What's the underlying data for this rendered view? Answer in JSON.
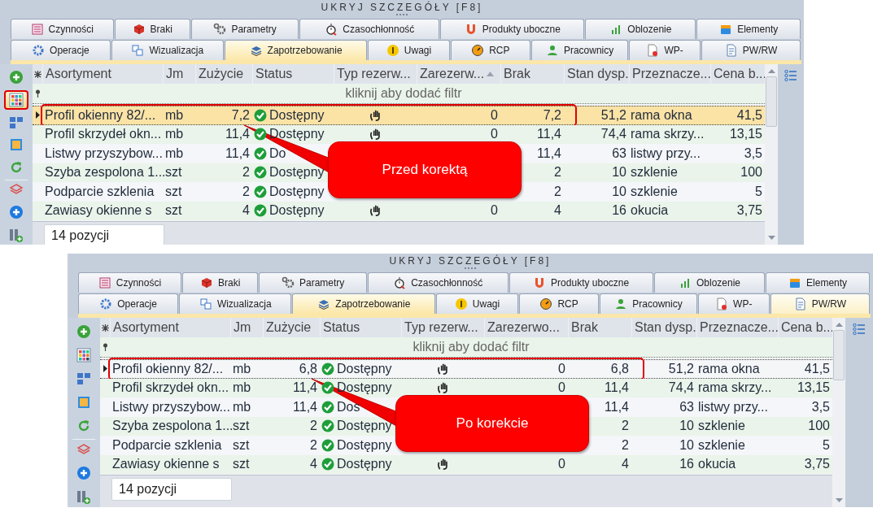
{
  "panels": [
    {
      "header": "UKRYJ SZCZEGÓŁY [F8]",
      "tabs_row_1": [
        {
          "label": "Czynności",
          "selected": false,
          "hover": false
        },
        {
          "label": "Braki",
          "selected": false,
          "hover": false
        },
        {
          "label": "Parametry",
          "selected": false,
          "hover": false
        },
        {
          "label": "Czasochłonność",
          "selected": false,
          "hover": false
        },
        {
          "label": "Produkty uboczne",
          "selected": false,
          "hover": false
        },
        {
          "label": "Oblozenie",
          "selected": false,
          "hover": false
        },
        {
          "label": "Elementy",
          "selected": false,
          "hover": false
        }
      ],
      "tabs_row_2": [
        {
          "label": "Operacje",
          "selected": false,
          "hover": false
        },
        {
          "label": "Wizualizacja",
          "selected": false,
          "hover": false
        },
        {
          "label": "Zapotrzebowanie",
          "selected": true,
          "hover": false
        },
        {
          "label": "Uwagi",
          "selected": false,
          "hover": false
        },
        {
          "label": "RCP",
          "selected": false,
          "hover": false
        },
        {
          "label": "Pracownicy",
          "selected": false,
          "hover": false
        },
        {
          "label": "WP-",
          "selected": false,
          "hover": false
        },
        {
          "label": "PW/RW",
          "selected": false,
          "hover": false
        }
      ],
      "toolbar": [
        {
          "selected": false,
          "outlined": false
        },
        {
          "selected": true,
          "outlined": true
        },
        {
          "selected": false,
          "outlined": false
        },
        {
          "selected": false,
          "outlined": false
        },
        {
          "selected": false,
          "outlined": false
        },
        {
          "selected": false,
          "outlined": false
        },
        {
          "selected": false,
          "outlined": false
        },
        {
          "selected": false,
          "outlined": false
        }
      ],
      "grid_focused": true,
      "columns": [
        {
          "label": "Asortyment"
        },
        {
          "label": "Jm"
        },
        {
          "label": "Zużycie"
        },
        {
          "label": "Status"
        },
        {
          "label": "Typ rezerw..."
        },
        {
          "label": "Zarezerw...",
          "sort_ascending": true
        },
        {
          "label": "Brak"
        },
        {
          "label": "Stan dysp."
        },
        {
          "label": "Przeznacze..."
        },
        {
          "label": "Cena b..."
        }
      ],
      "filter_hint": "kliknij aby dodać filtr",
      "rows": [
        {
          "name": "Profil okienny 82/...",
          "unit": "mb",
          "usage": "7,2",
          "status": "Dostępny",
          "reservation_icon": true,
          "reserved": "0",
          "shortage": "7,2",
          "available": "51,2",
          "purpose": "rama okna",
          "price": "41,5",
          "selected": true,
          "outlined": true
        },
        {
          "name": "Profil skrzydeł okn...",
          "unit": "mb",
          "usage": "11,4",
          "status": "Dostępny",
          "reservation_icon": true,
          "reserved": "0",
          "shortage": "11,4",
          "available": "74,4",
          "purpose": "rama skrzy...",
          "price": "13,15",
          "selected": false,
          "outlined": false
        },
        {
          "name": "Listwy przyszybow...",
          "unit": "mb",
          "usage": "11,4",
          "status": "Do",
          "shortage": "11,4",
          "available": "63",
          "purpose": "listwy przy...",
          "price": "3,5",
          "selected": false,
          "outlined": false
        },
        {
          "name": "Szyba zespolona 1...",
          "unit": "szt",
          "usage": "2",
          "status": "Dostępny",
          "shortage": "2",
          "available": "10",
          "purpose": "szklenie",
          "price": "100",
          "selected": false,
          "outlined": false
        },
        {
          "name": "Podparcie szklenia",
          "unit": "szt",
          "usage": "2",
          "status": "Dostępny",
          "shortage": "2",
          "available": "10",
          "purpose": "szklenie",
          "price": "5",
          "selected": false,
          "outlined": false
        },
        {
          "name": "Zawiasy okienne s",
          "unit": "szt",
          "usage": "4",
          "status": "Dostępny",
          "reservation_icon": true,
          "reserved": "0",
          "shortage": "4",
          "available": "16",
          "purpose": "okucia",
          "price": "3,75",
          "selected": false,
          "outlined": false
        }
      ],
      "count": "14 pozycji",
      "callout": "Przed korektą"
    },
    {
      "header": "UKRYJ SZCZEGÓŁY [F8]",
      "tabs_row_1": [
        {
          "label": "Czynności",
          "selected": false,
          "hover": false
        },
        {
          "label": "Braki",
          "selected": false,
          "hover": false
        },
        {
          "label": "Parametry",
          "selected": false,
          "hover": false
        },
        {
          "label": "Czasochłonność",
          "selected": false,
          "hover": false
        },
        {
          "label": "Produkty uboczne",
          "selected": false,
          "hover": false
        },
        {
          "label": "Oblozenie",
          "selected": false,
          "hover": false
        },
        {
          "label": "Elementy",
          "selected": false,
          "hover": false
        }
      ],
      "tabs_row_2": [
        {
          "label": "Operacje",
          "selected": false,
          "hover": false
        },
        {
          "label": "Wizualizacja",
          "selected": false,
          "hover": false
        },
        {
          "label": "Zapotrzebowanie",
          "selected": true,
          "hover": false
        },
        {
          "label": "Uwagi",
          "selected": false,
          "hover": false
        },
        {
          "label": "RCP",
          "selected": false,
          "hover": false
        },
        {
          "label": "Pracownicy",
          "selected": false,
          "hover": false
        },
        {
          "label": "WP-",
          "selected": false,
          "hover": false
        },
        {
          "label": "PW/RW",
          "selected": false,
          "hover": true
        }
      ],
      "toolbar": [
        {
          "selected": false,
          "outlined": false
        },
        {
          "selected": false,
          "outlined": false
        },
        {
          "selected": false,
          "outlined": false
        },
        {
          "selected": false,
          "outlined": false
        },
        {
          "selected": false,
          "outlined": false
        },
        {
          "selected": false,
          "outlined": false
        },
        {
          "selected": false,
          "outlined": false
        },
        {
          "selected": false,
          "outlined": false
        }
      ],
      "grid_focused": false,
      "columns": [
        {
          "label": "Asortyment"
        },
        {
          "label": "Jm"
        },
        {
          "label": "Zużycie"
        },
        {
          "label": "Status"
        },
        {
          "label": "Typ rezerw..."
        },
        {
          "label": "Zarezerwo...",
          "sort_ascending": false
        },
        {
          "label": "Brak"
        },
        {
          "label": "Stan dysp."
        },
        {
          "label": "Przeznacze..."
        },
        {
          "label": "Cena b..."
        }
      ],
      "filter_hint": "kliknij aby dodać filtr",
      "rows": [
        {
          "name": "Profil okienny 82/...",
          "unit": "mb",
          "usage": "6,8",
          "status": "Dostępny",
          "reservation_icon": true,
          "reserved": "0",
          "shortage": "6,8",
          "available": "51,2",
          "purpose": "rama okna",
          "price": "41,5",
          "selected": true,
          "outlined": true
        },
        {
          "name": "Profil skrzydeł okn...",
          "unit": "mb",
          "usage": "11,4",
          "status": "Dostępny",
          "reservation_icon": true,
          "reserved": "0",
          "shortage": "11,4",
          "available": "74,4",
          "purpose": "rama skrzy...",
          "price": "13,15",
          "selected": false,
          "outlined": false
        },
        {
          "name": "Listwy przyszybow...",
          "unit": "mb",
          "usage": "11,4",
          "status": "Dos",
          "shortage": "11,4",
          "available": "63",
          "purpose": "listwy przy...",
          "price": "3,5",
          "selected": false,
          "outlined": false
        },
        {
          "name": "Szyba zespolona 1...",
          "unit": "szt",
          "usage": "2",
          "status": "Dostępny",
          "shortage": "2",
          "available": "10",
          "purpose": "szklenie",
          "price": "100",
          "selected": false,
          "outlined": false
        },
        {
          "name": "Podparcie szklenia",
          "unit": "szt",
          "usage": "2",
          "status": "Dostępny",
          "shortage": "2",
          "available": "10",
          "purpose": "szklenie",
          "price": "5",
          "selected": false,
          "outlined": false
        },
        {
          "name": "Zawiasy okienne s",
          "unit": "szt",
          "usage": "4",
          "status": "Dostępny",
          "reservation_icon": true,
          "reserved": "0",
          "shortage": "4",
          "available": "16",
          "purpose": "okucia",
          "price": "3,75",
          "selected": false,
          "outlined": false
        }
      ],
      "count": "14 pozycji",
      "callout": "Po korekcie"
    }
  ]
}
